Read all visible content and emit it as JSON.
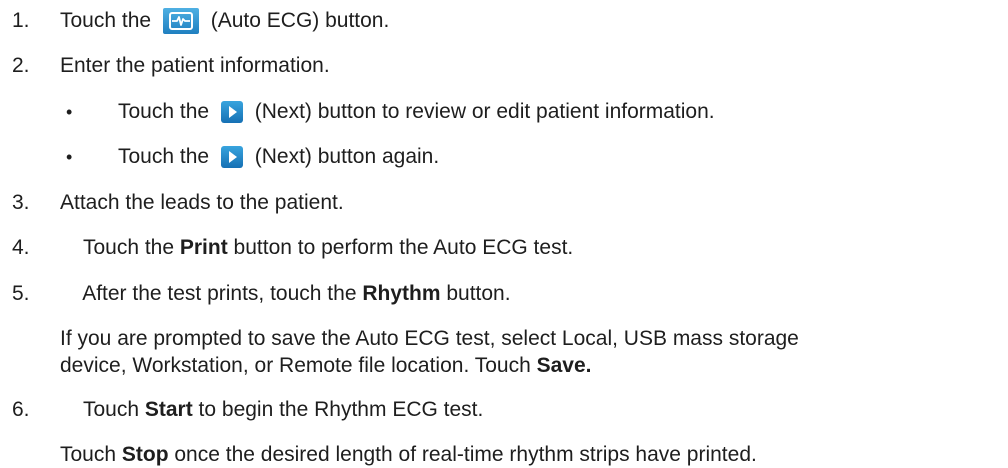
{
  "steps": [
    {
      "number": "1.",
      "pre": "Touch the ",
      "icon_name": "auto-ecg-icon",
      "post": " (Auto ECG) button."
    },
    {
      "number": "2.",
      "text": "Enter the patient information."
    },
    {
      "number": "3.",
      "text": "Attach the leads to the patient."
    },
    {
      "number": "4.",
      "pre": "Touch the ",
      "bold": "Print",
      "post": " button to perform the Auto ECG test."
    },
    {
      "number": "5.",
      "pre": "After the test prints, touch the ",
      "bold": "Rhythm",
      "post": " button."
    },
    {
      "number": "6.",
      "pre": "Touch ",
      "bold": "Start",
      "post": " to begin the Rhythm ECG test."
    }
  ],
  "bullets": [
    {
      "symbol": "•",
      "pre": "Touch the ",
      "icon_name": "next-icon",
      "post": " (Next) button to review or edit patient information."
    },
    {
      "symbol": "•",
      "pre": "Touch the ",
      "icon_name": "next-icon",
      "post": " (Next) button again."
    }
  ],
  "notes": {
    "step5_line1": "If you are prompted to save the Auto ECG test, select Local, USB mass storage",
    "step5_line2_pre": "device, Workstation, or Remote file location. Touch ",
    "step5_line2_bold": "Save.",
    "step6_pre": "Touch ",
    "step6_bold": "Stop",
    "step6_post": " once the desired length of real-time rhythm strips have printed."
  },
  "colors": {
    "icon_blue_light": "#4fb0e3",
    "icon_blue_dark": "#1670b4",
    "text": "#1e1e1e"
  }
}
